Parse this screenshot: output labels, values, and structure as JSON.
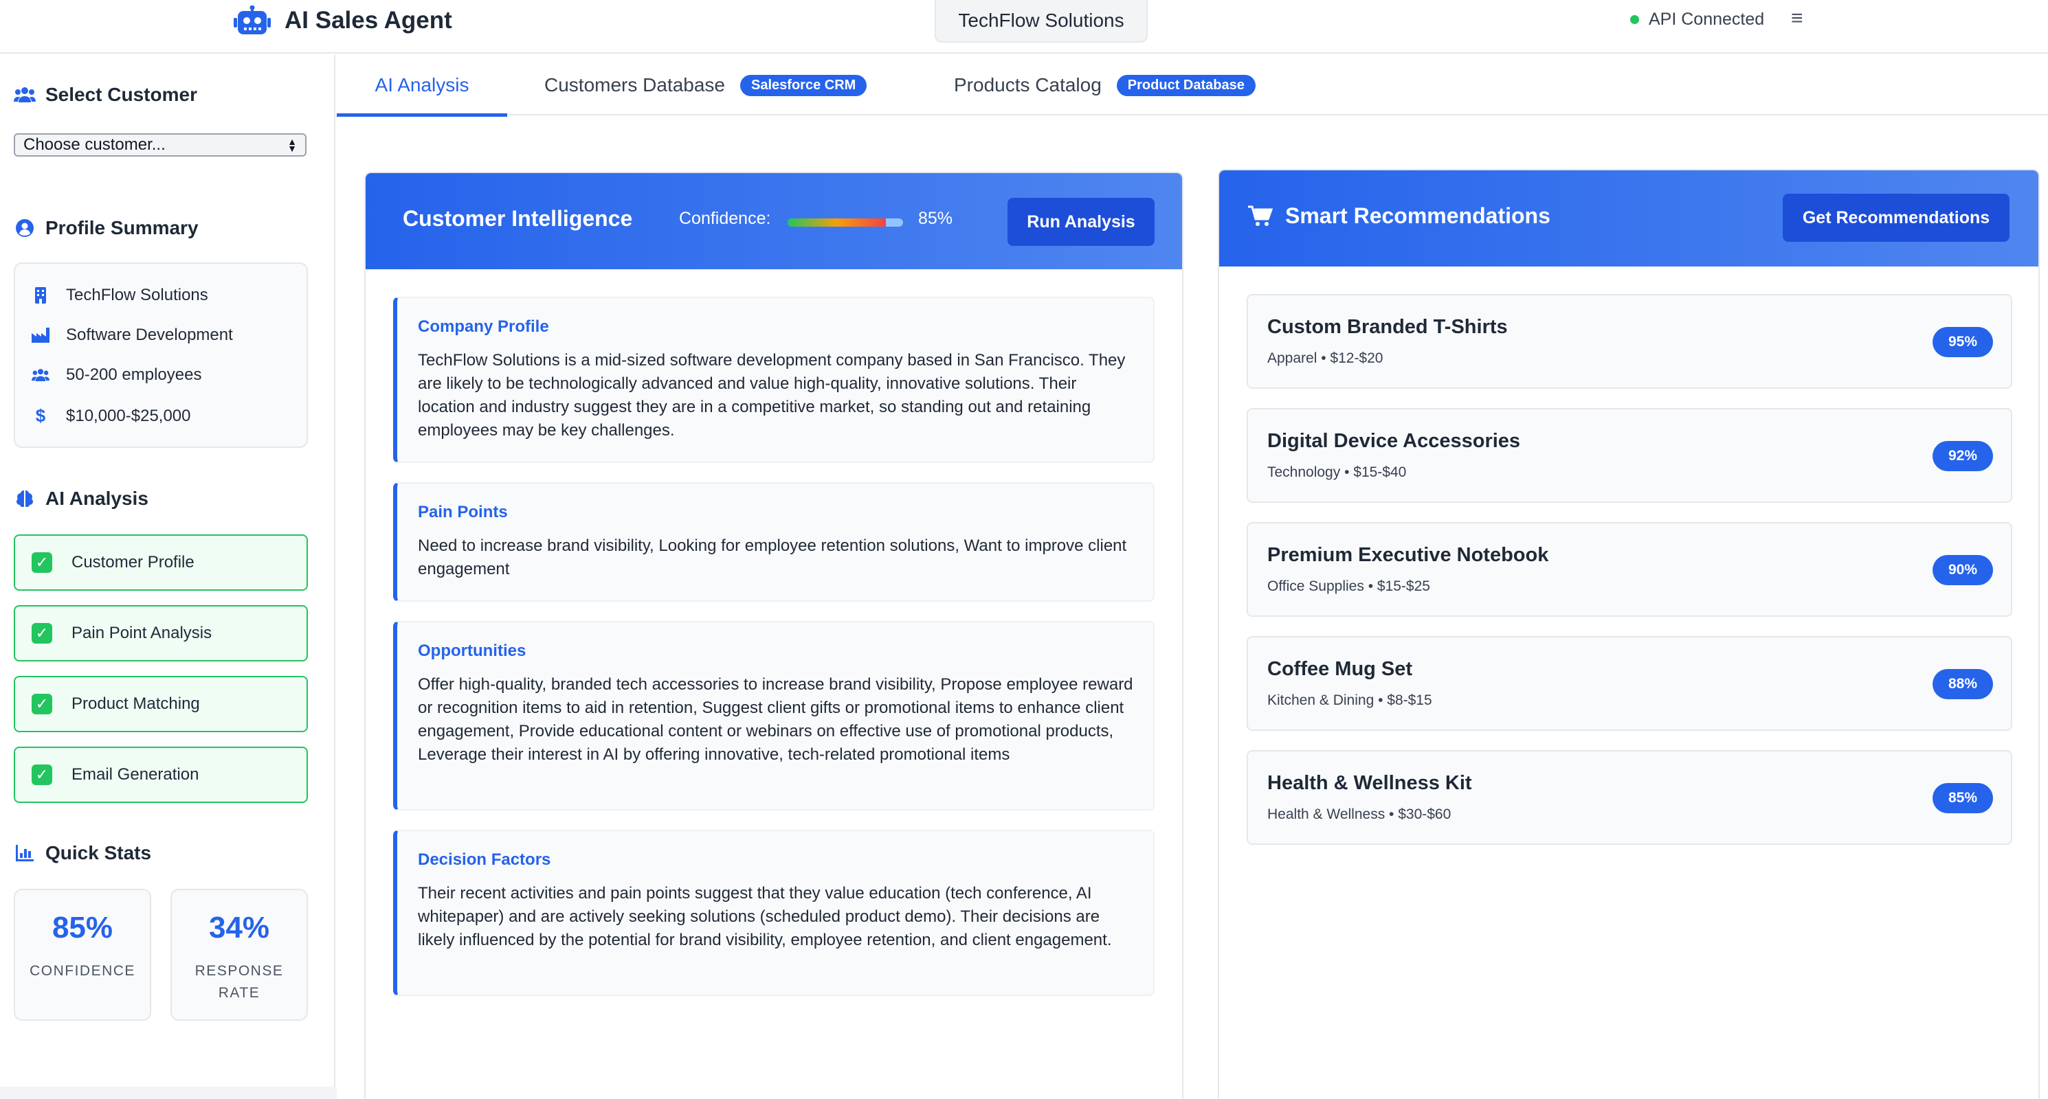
{
  "header": {
    "app_title": "AI Sales Agent",
    "company": "TechFlow Solutions",
    "api_status": "API Connected",
    "menu_glyph": "≡"
  },
  "sidebar": {
    "select_customer": {
      "heading": "Select Customer",
      "selected": "Choose customer..."
    },
    "profile_summary": {
      "heading": "Profile Summary",
      "rows": [
        {
          "icon": "building-icon",
          "text": "TechFlow Solutions"
        },
        {
          "icon": "industry-icon",
          "text": "Software Development"
        },
        {
          "icon": "users-icon",
          "text": "50-200 employees"
        },
        {
          "icon": "dollar-icon",
          "text": "$10,000-$25,000"
        }
      ]
    },
    "ai_analysis": {
      "heading": "AI Analysis",
      "steps": [
        "Customer Profile",
        "Pain Point Analysis",
        "Product Matching",
        "Email Generation"
      ]
    },
    "quick_stats": {
      "heading": "Quick Stats",
      "stats": [
        {
          "value": "85%",
          "label": "CONFIDENCE"
        },
        {
          "value": "34%",
          "label": "RESPONSE RATE"
        }
      ]
    }
  },
  "tabs": [
    {
      "label": "AI Analysis",
      "badge": ""
    },
    {
      "label": "Customers Database",
      "badge": "Salesforce CRM"
    },
    {
      "label": "Products Catalog",
      "badge": "Product Database"
    }
  ],
  "intelligence": {
    "title": "Customer Intelligence",
    "confidence_label": "Confidence:",
    "confidence_value": "85%",
    "confidence_level": 0.85,
    "button": "Run Analysis",
    "sections": [
      {
        "title": "Company Profile",
        "text": "TechFlow Solutions is a mid-sized software development company based in San Francisco. They are likely to be technologically advanced and value high-quality, innovative solutions. Their location and industry suggest they are in a competitive market, so standing out and retaining employees may be key challenges."
      },
      {
        "title": "Pain Points",
        "text": "Need to increase brand visibility, Looking for employee retention solutions, Want to improve client engagement"
      },
      {
        "title": "Opportunities",
        "text": "Offer high-quality, branded tech accessories to increase brand visibility, Propose employee reward or recognition items to aid in retention, Suggest client gifts or promotional items to enhance client engagement, Provide educational content or webinars on effective use of promotional products, Leverage their interest in AI by offering innovative, tech-related promotional items"
      },
      {
        "title": "Decision Factors",
        "text": "Their recent activities and pain points suggest that they value education (tech conference, AI whitepaper) and are actively seeking solutions (scheduled product demo). Their decisions are likely influenced by the potential for brand visibility, employee retention, and client engagement."
      }
    ]
  },
  "recommendations": {
    "title": "Smart Recommendations",
    "button": "Get Recommendations",
    "items": [
      {
        "name": "Custom Branded T-Shirts",
        "meta": "Apparel • $12-$20",
        "score": "95%"
      },
      {
        "name": "Digital Device Accessories",
        "meta": "Technology • $15-$40",
        "score": "92%"
      },
      {
        "name": "Premium Executive Notebook",
        "meta": "Office Supplies • $15-$25",
        "score": "90%"
      },
      {
        "name": "Coffee Mug Set",
        "meta": "Kitchen & Dining • $8-$15",
        "score": "88%"
      },
      {
        "name": "Health & Wellness Kit",
        "meta": "Health & Wellness • $30-$60",
        "score": "85%"
      }
    ]
  },
  "colors": {
    "accent": "#2563eb",
    "success": "#22c55e",
    "success_bg": "#f0fdf4"
  }
}
